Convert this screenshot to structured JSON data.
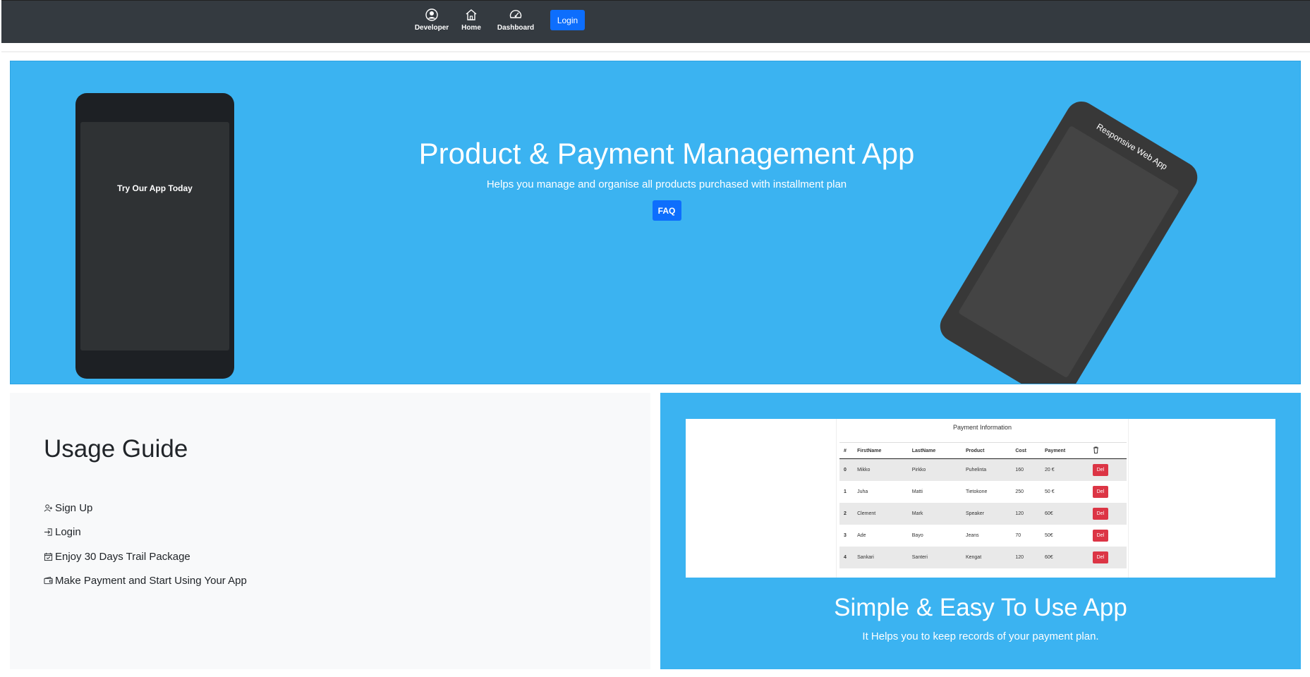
{
  "navbar": {
    "items": [
      {
        "label": "Developer",
        "icon": "user-circle-icon"
      },
      {
        "label": "Home",
        "icon": "house-icon"
      },
      {
        "label": "Dashboard",
        "icon": "speedometer-icon"
      }
    ],
    "login_label": "Login"
  },
  "hero": {
    "phone_text": "Try Our App Today",
    "title": "Product & Payment Management App",
    "subtitle": "Helps you manage and organise all products purchased with installment plan",
    "faq_label": "FAQ",
    "tilted_phone_text": "Responsive Web App"
  },
  "guide": {
    "title": "Usage Guide",
    "steps": [
      {
        "label": "Sign Up",
        "icon": "person-add-icon"
      },
      {
        "label": "Login",
        "icon": "login-icon"
      },
      {
        "label": "Enjoy 30 Days Trail Package",
        "icon": "calendar-check-icon"
      },
      {
        "label": "Make Payment and Start Using Your App",
        "icon": "wallet-icon"
      }
    ]
  },
  "showcase": {
    "table_title": "Payment Information",
    "columns": [
      "#",
      "FirstName",
      "LastName",
      "Product",
      "Cost",
      "Payment"
    ],
    "delete_col_icon": "trash-icon",
    "rows": [
      [
        "0",
        "Mikko",
        "Pirkko",
        "Puhelinta",
        "160",
        "20 €"
      ],
      [
        "1",
        "Juha",
        "Matti",
        "Tietokone",
        "250",
        "50 €"
      ],
      [
        "2",
        "Clement",
        "Mark",
        "Speaker",
        "120",
        "60€"
      ],
      [
        "3",
        "Ade",
        "Bayo",
        "Jeans",
        "70",
        "50€"
      ],
      [
        "4",
        "Sankari",
        "Santeri",
        "Kengat",
        "120",
        "60€"
      ]
    ],
    "delete_label": "Del",
    "title": "Simple & Easy To Use App",
    "subtitle": "It Helps you to keep records of your payment plan."
  },
  "colors": {
    "navbar_bg": "#343a40",
    "hero_bg": "#3bb3f1",
    "primary": "#0d6efd",
    "danger": "#dc3545",
    "light_bg": "#f8f9fa"
  }
}
